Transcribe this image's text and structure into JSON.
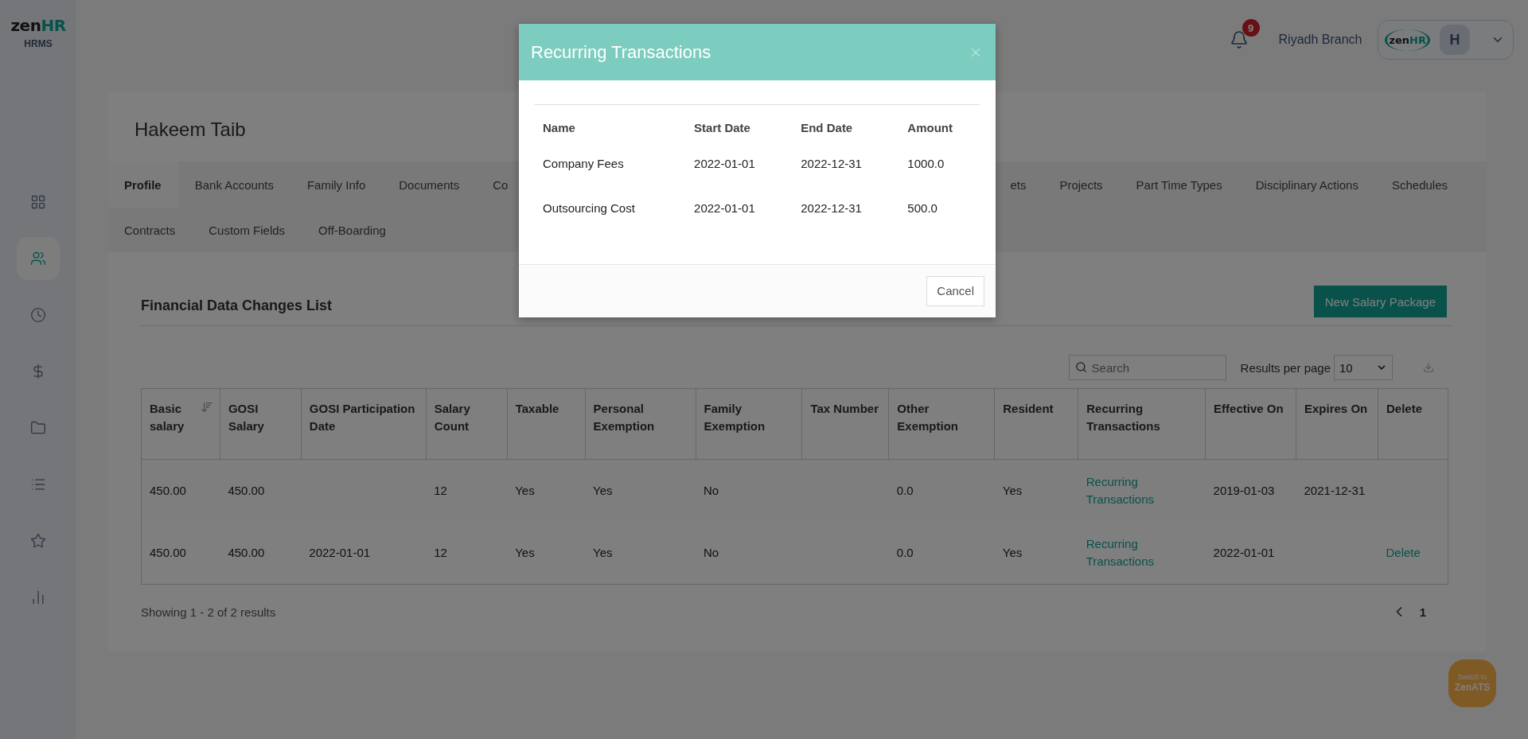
{
  "logo": {
    "word": "zen",
    "accent": "HR",
    "subtitle": "HRMS"
  },
  "sidebar": {
    "items": [
      {
        "selected": false
      },
      {
        "selected": true
      },
      {
        "selected": false
      },
      {
        "selected": false
      },
      {
        "selected": false
      },
      {
        "selected": false
      },
      {
        "selected": false
      },
      {
        "selected": false
      }
    ]
  },
  "header": {
    "notifications": "9",
    "branch": "Riyadh Branch",
    "company_logo": {
      "word": "zen",
      "accent": "HR"
    },
    "avatar": "H"
  },
  "employee": {
    "name": "Hakeem Taib"
  },
  "tabs": {
    "row_1_left": [
      {
        "label": "Profile",
        "selected": true
      },
      {
        "label": "Bank Accounts",
        "selected": false
      },
      {
        "label": "Family Info",
        "selected": false
      },
      {
        "label": "Documents",
        "selected": false
      },
      {
        "label": "Co",
        "selected": false
      }
    ],
    "row_1_right": [
      {
        "label": "ets",
        "selected": false
      },
      {
        "label": "Projects",
        "selected": false
      },
      {
        "label": "Part Time Types",
        "selected": false
      },
      {
        "label": "Disciplinary Actions",
        "selected": false
      },
      {
        "label": "Schedules",
        "selected": false
      }
    ],
    "row_2": [
      {
        "label": "Contracts",
        "selected": false
      },
      {
        "label": "Custom Fields",
        "selected": false
      },
      {
        "label": "Off-Boarding",
        "selected": false
      }
    ]
  },
  "section": {
    "title": "Financial Data Changes List",
    "new_button": "New Salary Package"
  },
  "table_tools": {
    "search": {
      "placeholder": "Search"
    },
    "results_label": "Results per page",
    "results_value": "10"
  },
  "table": {
    "columns": [
      {
        "label": "Basic salary",
        "sorted": true
      },
      {
        "label": "GOSI Salary",
        "sorted": false
      },
      {
        "label": "GOSI Participation Date",
        "sorted": false
      },
      {
        "label": "Salary Count",
        "sorted": false
      },
      {
        "label": "Taxable",
        "sorted": false
      },
      {
        "label": "Personal Exemption",
        "sorted": false
      },
      {
        "label": "Family Exemption",
        "sorted": false
      },
      {
        "label": "Tax Number",
        "sorted": false
      },
      {
        "label": "Other Exemption",
        "sorted": false
      },
      {
        "label": "Resident",
        "sorted": false
      },
      {
        "label": "Recurring Transactions",
        "sorted": false
      },
      {
        "label": "Effective On",
        "sorted": false
      },
      {
        "label": "Expires On",
        "sorted": false
      },
      {
        "label": "Delete",
        "sorted": false
      }
    ],
    "rows": [
      {
        "cells": [
          {
            "kind": "text",
            "text": "450.00"
          },
          {
            "kind": "text",
            "text": "450.00"
          },
          {
            "kind": "blank"
          },
          {
            "kind": "text",
            "text": "12"
          },
          {
            "kind": "text",
            "text": "Yes"
          },
          {
            "kind": "text",
            "text": "Yes"
          },
          {
            "kind": "text",
            "text": "No"
          },
          {
            "kind": "blank"
          },
          {
            "kind": "text",
            "text": "0.0"
          },
          {
            "kind": "text",
            "text": "Yes"
          },
          {
            "kind": "link",
            "text": "Recurring Transactions"
          },
          {
            "kind": "text",
            "text": "2019-01-03"
          },
          {
            "kind": "text",
            "text": "2021-12-31"
          },
          {
            "kind": "blank"
          }
        ]
      },
      {
        "cells": [
          {
            "kind": "text",
            "text": "450.00"
          },
          {
            "kind": "text",
            "text": "450.00"
          },
          {
            "kind": "text",
            "text": "2022-01-01"
          },
          {
            "kind": "text",
            "text": "12"
          },
          {
            "kind": "text",
            "text": "Yes"
          },
          {
            "kind": "text",
            "text": "Yes"
          },
          {
            "kind": "text",
            "text": "No"
          },
          {
            "kind": "blank"
          },
          {
            "kind": "text",
            "text": "0.0"
          },
          {
            "kind": "text",
            "text": "Yes"
          },
          {
            "kind": "link",
            "text": "Recurring Transactions"
          },
          {
            "kind": "text",
            "text": "2022-01-01"
          },
          {
            "kind": "blank"
          },
          {
            "kind": "link",
            "text": "Delete"
          }
        ]
      }
    ]
  },
  "footer": {
    "summary": "Showing 1 - 2 of 2 results",
    "page": "1"
  },
  "switch_button": {
    "line_1": "Switch to",
    "line_2": "ZenATS"
  },
  "dialog": {
    "title": "Recurring Transactions",
    "columns": [
      "Name",
      "Start Date",
      "End Date",
      "Amount"
    ],
    "rows": [
      [
        "Company Fees",
        "2022-01-01",
        "2022-12-31",
        "1000.0"
      ],
      [
        "Outsourcing Cost",
        "2022-01-01",
        "2022-12-31",
        "500.0"
      ]
    ],
    "cancel": "Cancel"
  }
}
